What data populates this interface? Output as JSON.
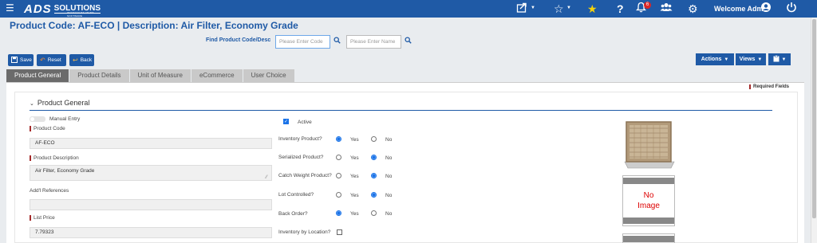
{
  "header": {
    "brand": "ADS",
    "brand_suffix": "SOLUTIONS",
    "brand_tagline": "WAREHOUSE MGMT SOFTWARE",
    "notification_count": "6",
    "welcome": "Welcome Admin"
  },
  "page": {
    "title": "Product Code:  AF-ECO | Description: Air Filter, Economy Grade",
    "find_label": "Find Product Code/Desc",
    "code_placeholder": "Please Enter Code",
    "name_placeholder": "Please Enter Name"
  },
  "toolbar": {
    "save": "Save",
    "reset": "Reset",
    "back": "Back",
    "actions": "Actions",
    "views": "Views"
  },
  "tabs": [
    "Product General",
    "Product Details",
    "Unit of Measure",
    "eCommerce",
    "User Choice"
  ],
  "required_fields": "Required Fields",
  "section": {
    "title": "Product General",
    "manual_entry": "Manual Entry",
    "product_code_label": "Product Code",
    "product_code": "AF-ECO",
    "product_desc_label": "Product Description",
    "product_desc": "Air Filter, Economy Grade",
    "refs_label": "Add'l References",
    "refs": "",
    "list_price_label": "List Price",
    "list_price": "7.79323",
    "active_label": "Active",
    "active": true,
    "questions": [
      {
        "label": "Inventory Product?",
        "value": "Yes"
      },
      {
        "label": "Serialized Product?",
        "value": "No"
      },
      {
        "label": "Catch Weight Product?",
        "value": "No"
      },
      {
        "label": "Lot Controlled?",
        "value": "No"
      },
      {
        "label": "Back Order?",
        "value": "Yes"
      }
    ],
    "yes": "Yes",
    "no": "No",
    "inventory_by_location": "Inventory by Location?",
    "no_image_line1": "No",
    "no_image_line2": "Image"
  }
}
